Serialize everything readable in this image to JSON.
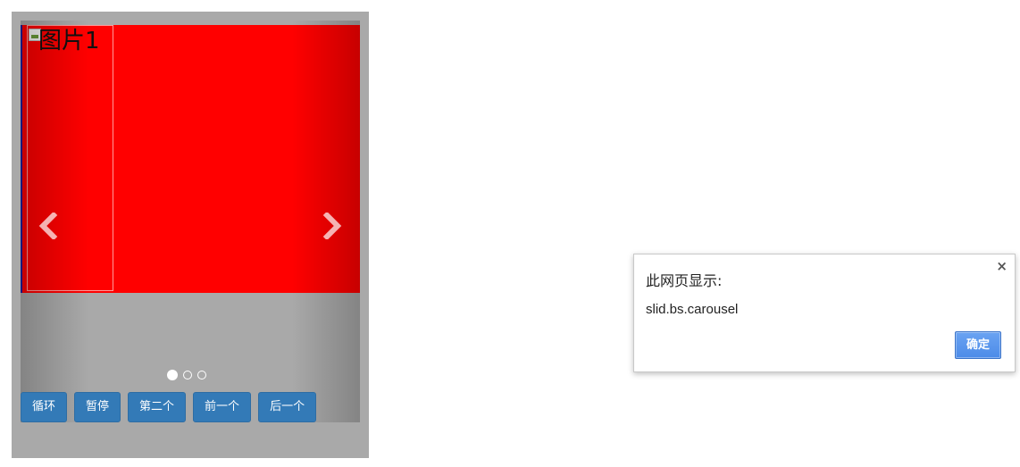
{
  "carousel": {
    "slide_image_alt": "图片1",
    "indicators": [
      {
        "label": "slide-1",
        "active": true
      },
      {
        "label": "slide-2",
        "active": false
      },
      {
        "label": "slide-3",
        "active": false
      }
    ],
    "prev_icon": "chevron-left-icon",
    "next_icon": "chevron-right-icon"
  },
  "buttons": {
    "cycle": "循环",
    "pause": "暂停",
    "second": "第二个",
    "prev": "前一个",
    "next": "后一个"
  },
  "dialog": {
    "title": "此网页显示:",
    "message": "slid.bs.carousel",
    "ok_label": "确定",
    "close_glyph": "×"
  },
  "colors": {
    "slide_background": "#ff0000",
    "panel_background": "#a9a9a9",
    "button_primary": "#337ab7",
    "dialog_ok": "#4c8be8"
  }
}
